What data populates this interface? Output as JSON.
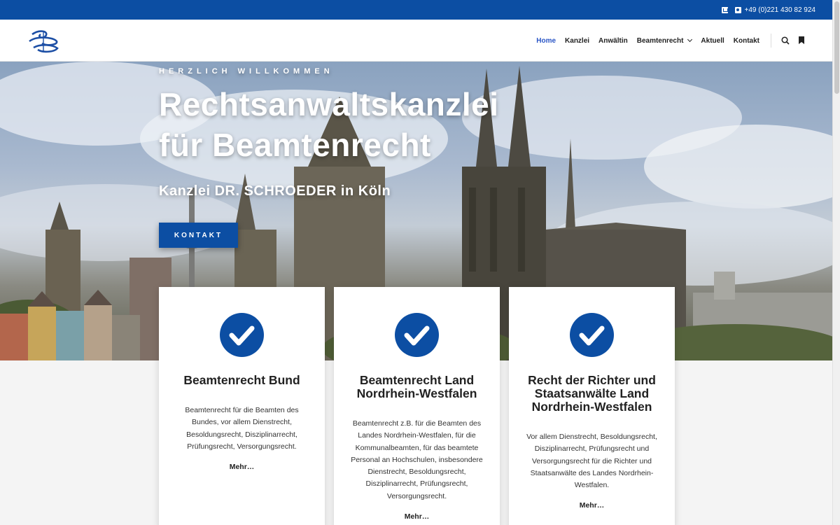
{
  "topbar": {
    "phone": "+49 (0)221 430 82 924"
  },
  "nav": {
    "items": [
      "Home",
      "Kanzlei",
      "Anwältin",
      "Beamtenrecht",
      "Aktuell",
      "Kontakt"
    ]
  },
  "hero": {
    "kicker": "HERZLICH WILLKOMMEN",
    "title_line1": "Rechtsanwaltskanzlei",
    "title_line2": "für Beamtenrecht",
    "subtitle": "Kanzlei DR. SCHROEDER in Köln",
    "cta": "KONTAKT"
  },
  "cards": [
    {
      "title_lines": [
        "Beamtenrecht Bund"
      ],
      "text_lines": [
        "Beamtenrecht für die Beamten des",
        "Bundes, vor allem Dienstrecht,",
        "Besoldungsrecht, Disziplinarrecht,",
        "Prüfungsrecht, Versorgungsrecht."
      ],
      "more": "Mehr…"
    },
    {
      "title_lines": [
        "Beamtenrecht Land",
        "Nordrhein-Westfalen"
      ],
      "text_lines": [
        "Beamtenrecht z.B. für die Beamten des",
        "Landes Nordrhein-Westfalen, für die",
        "Kommunalbeamten, für das beamtete",
        "Personal an Hochschulen, insbesondere",
        "Dienstrecht, Besoldungsrecht,",
        "Disziplinarrecht, Prüfungsrecht,",
        "Versorgungsrecht."
      ],
      "more": "Mehr…"
    },
    {
      "title_lines": [
        "Recht der Richter und",
        "Staatsanwälte Land",
        "Nordrhein-Westfalen"
      ],
      "text_lines": [
        "Vor allem Dienstrecht, Besoldungsrecht,",
        "Disziplinarrecht, Prüfungsrecht und",
        "Versorgungsrecht für die Richter und",
        "Staatsanwälte des Landes Nordrhein-",
        "Westfalen."
      ],
      "more": "Mehr…"
    }
  ],
  "colors": {
    "brand": "#0c4ea3",
    "nav_active": "#2b56c6"
  }
}
